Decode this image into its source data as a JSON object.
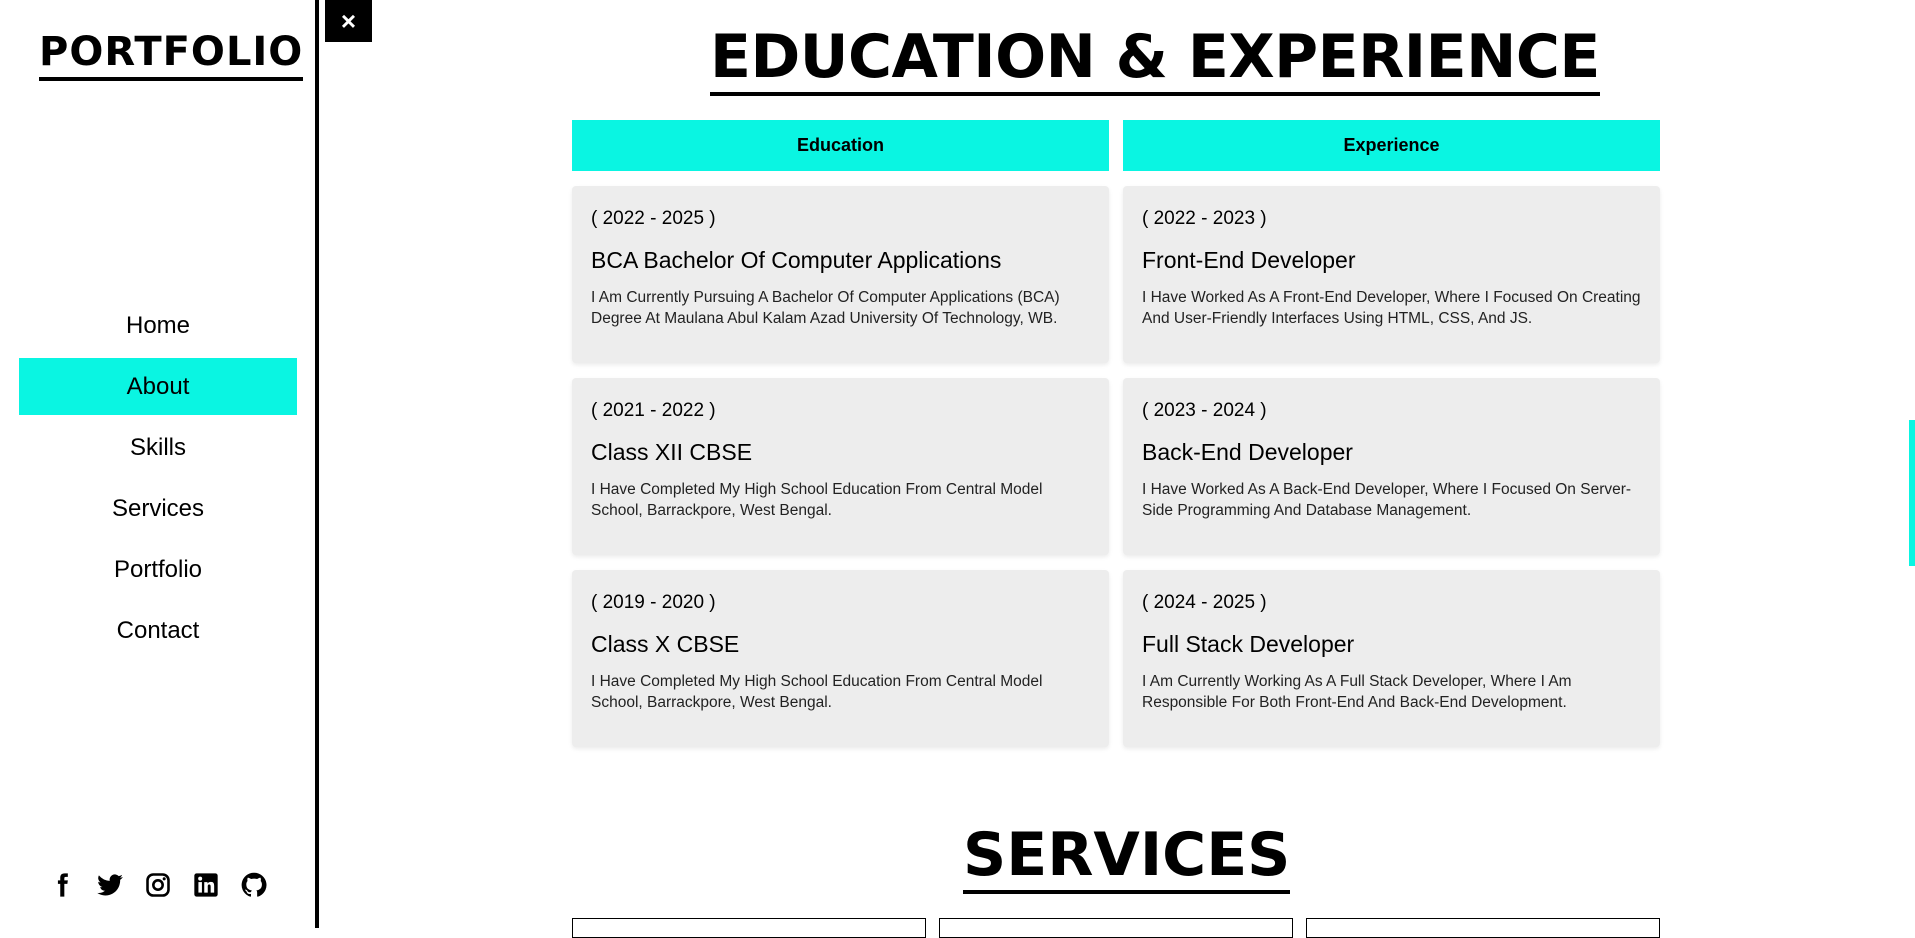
{
  "sidebar": {
    "logo": "PORTFOLIO",
    "nav": [
      "Home",
      "About",
      "Skills",
      "Services",
      "Portfolio",
      "Contact"
    ],
    "active": "About",
    "socials": [
      "facebook-icon",
      "twitter-icon",
      "instagram-icon",
      "linkedin-icon",
      "github-icon"
    ]
  },
  "close_label": "×",
  "education_experience": {
    "title": "EDUCATION & EXPERIENCE",
    "education_header": "Education",
    "experience_header": "Experience",
    "education": [
      {
        "years": "( 2022 - 2025 )",
        "title": "BCA Bachelor Of Computer Applications",
        "desc": "I Am Currently Pursuing A Bachelor Of Computer Applications (BCA) Degree At Maulana Abul Kalam Azad University Of Technology, WB."
      },
      {
        "years": "( 2021 - 2022 )",
        "title": "Class XII CBSE",
        "desc": "I Have Completed My High School Education From Central Model School, Barrackpore, West Bengal."
      },
      {
        "years": "( 2019 - 2020 )",
        "title": "Class X CBSE",
        "desc": "I Have Completed My High School Education From Central Model School, Barrackpore, West Bengal."
      }
    ],
    "experience": [
      {
        "years": "( 2022 - 2023 )",
        "title": "Front-End Developer",
        "desc": "I Have Worked As A Front-End Developer, Where I Focused On Creating And User-Friendly Interfaces Using HTML, CSS, And JS."
      },
      {
        "years": "( 2023 - 2024 )",
        "title": "Back-End Developer",
        "desc": "I Have Worked As A Back-End Developer, Where I Focused On Server-Side Programming And Database Management."
      },
      {
        "years": "( 2024 - 2025 )",
        "title": "Full Stack Developer",
        "desc": "I Am Currently Working As A Full Stack Developer, Where I Am Responsible For Both Front-End And Back-End Development."
      }
    ]
  },
  "services": {
    "title": "SERVICES"
  },
  "colors": {
    "accent": "#0af5e2",
    "card_bg": "#ededed",
    "text": "#000000"
  }
}
